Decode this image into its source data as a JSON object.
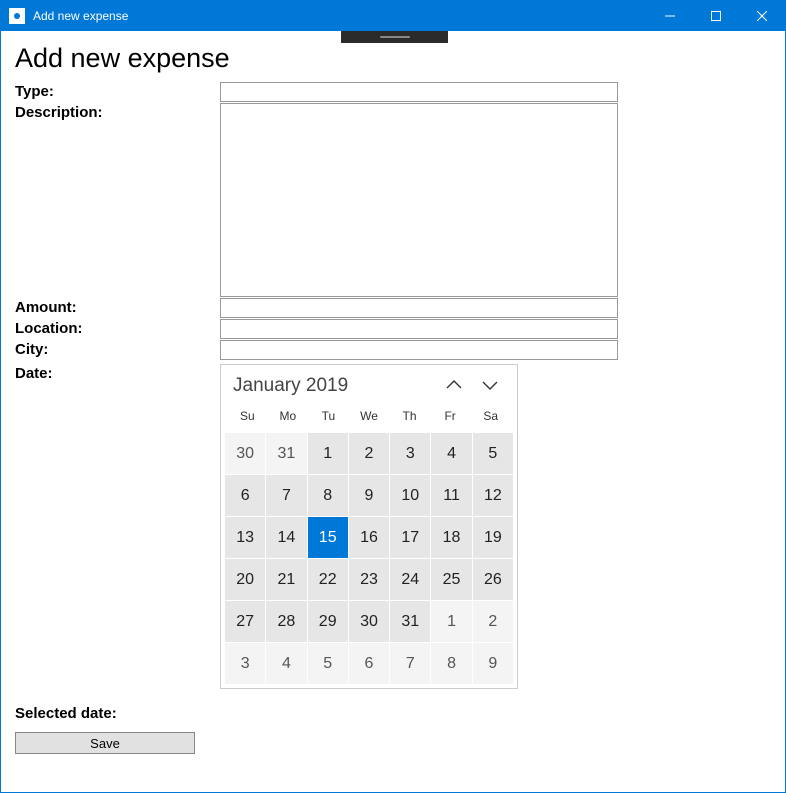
{
  "window": {
    "title": "Add new expense"
  },
  "heading": "Add new expense",
  "labels": {
    "type": "Type:",
    "description": "Description:",
    "amount": "Amount:",
    "location": "Location:",
    "city": "City:",
    "date": "Date:",
    "selected_date": "Selected date:"
  },
  "fields": {
    "type": "",
    "description": "",
    "amount": "",
    "location": "",
    "city": ""
  },
  "calendar": {
    "month_label": "January 2019",
    "day_headers": [
      "Su",
      "Mo",
      "Tu",
      "We",
      "Th",
      "Fr",
      "Sa"
    ],
    "selected_day": 15,
    "weeks": [
      [
        {
          "d": 30,
          "out": true
        },
        {
          "d": 31,
          "out": true
        },
        {
          "d": 1
        },
        {
          "d": 2
        },
        {
          "d": 3
        },
        {
          "d": 4
        },
        {
          "d": 5
        }
      ],
      [
        {
          "d": 6
        },
        {
          "d": 7
        },
        {
          "d": 8
        },
        {
          "d": 9
        },
        {
          "d": 10
        },
        {
          "d": 11
        },
        {
          "d": 12
        }
      ],
      [
        {
          "d": 13
        },
        {
          "d": 14
        },
        {
          "d": 15,
          "sel": true
        },
        {
          "d": 16
        },
        {
          "d": 17
        },
        {
          "d": 18
        },
        {
          "d": 19
        }
      ],
      [
        {
          "d": 20
        },
        {
          "d": 21
        },
        {
          "d": 22
        },
        {
          "d": 23
        },
        {
          "d": 24
        },
        {
          "d": 25
        },
        {
          "d": 26
        }
      ],
      [
        {
          "d": 27
        },
        {
          "d": 28
        },
        {
          "d": 29
        },
        {
          "d": 30
        },
        {
          "d": 31
        },
        {
          "d": 1,
          "out": true
        },
        {
          "d": 2,
          "out": true
        }
      ],
      [
        {
          "d": 3,
          "out": true
        },
        {
          "d": 4,
          "out": true
        },
        {
          "d": 5,
          "out": true
        },
        {
          "d": 6,
          "out": true
        },
        {
          "d": 7,
          "out": true
        },
        {
          "d": 8,
          "out": true
        },
        {
          "d": 9,
          "out": true
        }
      ]
    ]
  },
  "buttons": {
    "save": "Save"
  },
  "colors": {
    "accent": "#0078d7"
  }
}
